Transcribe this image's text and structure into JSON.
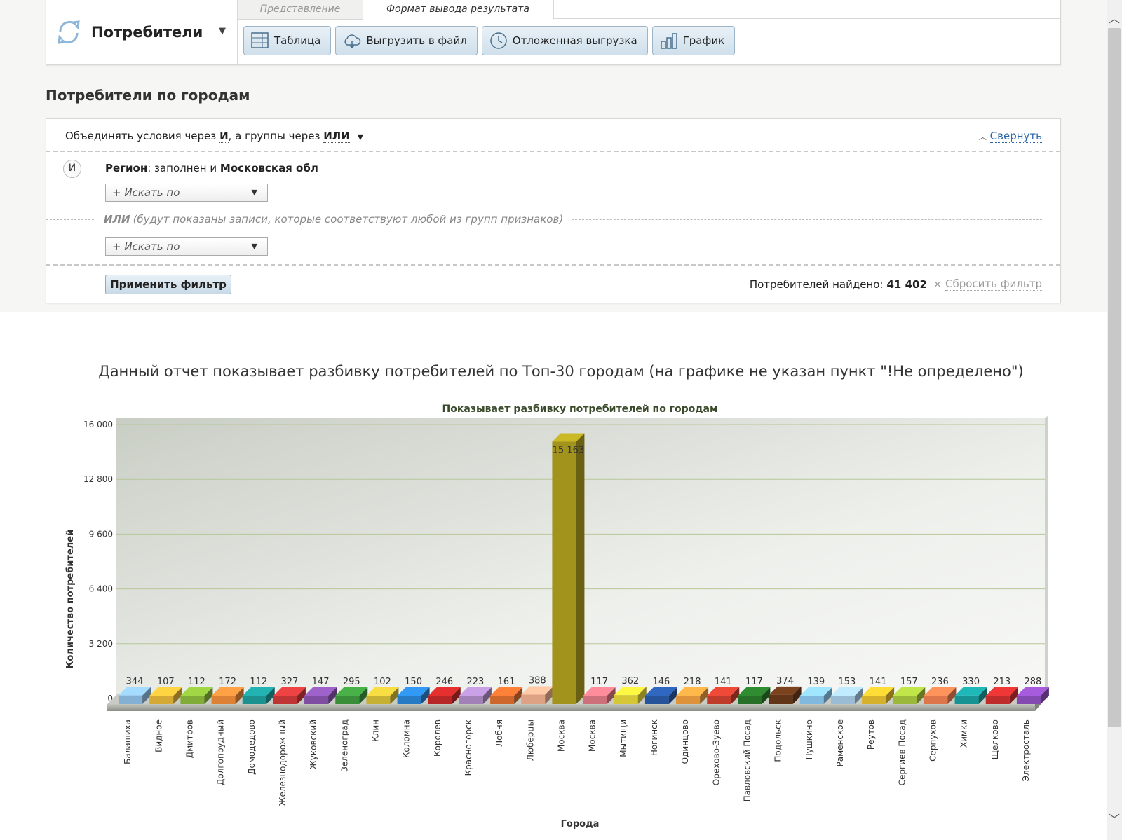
{
  "header": {
    "entity_name": "Потребители",
    "tabs": {
      "view": "Представление",
      "output_format": "Формат вывода результата"
    },
    "buttons": {
      "table": "Таблица",
      "export": "Выгрузить в файл",
      "deferred_export": "Отложенная выгрузка",
      "chart": "График"
    }
  },
  "page": {
    "title": "Потребители по городам"
  },
  "filter": {
    "combine_prefix": "Объединять условия через",
    "combine_and": "И",
    "combine_mid": ", а группы через",
    "combine_or": "ИЛИ",
    "collapse": "Свернуть",
    "and_badge": "И",
    "condition_field": "Регион",
    "condition_mid": ": заполнен и",
    "condition_value": "Московская обл",
    "search_placeholder": "+ Искать по",
    "or_label": "ИЛИ",
    "or_note": "(будут показаны записи, которые соответствуют любой из групп признаков)",
    "apply": "Применить фильтр",
    "found_label": "Потребителей найдено:",
    "found_count": "41 402",
    "reset": "Сбросить фильтр"
  },
  "report": {
    "caption": "Данный отчет показывает разбивку потребителей по Топ-30 городам (на графике не указан пункт \"!Не определено\")"
  },
  "chart_data": {
    "type": "bar",
    "title": "Показывает разбивку потребителей по городам",
    "xlabel": "Города",
    "ylabel": "Количество потребителей",
    "ylim": [
      0,
      16000
    ],
    "yticks": [
      0,
      3200,
      6400,
      9600,
      12800,
      16000
    ],
    "ytick_labels": [
      "0",
      "3 200",
      "6 400",
      "9 600",
      "12 800",
      "16 000"
    ],
    "categories": [
      "Балашиха",
      "Видное",
      "Дмитров",
      "Долгопрудный",
      "Домодедово",
      "Железнодорожный",
      "Жуковский",
      "Зеленоград",
      "Клин",
      "Коломна",
      "Королев",
      "Красногорск",
      "Лобня",
      "Люберцы",
      "Москва",
      "Москва",
      "Мытищи",
      "Ногинск",
      "Одинцово",
      "Орехово-Зуево",
      "Павловский Посад",
      "Подольск",
      "Пушкино",
      "Раменское",
      "Реутов",
      "Сергиев Посад",
      "Серпухов",
      "Химки",
      "Щелково",
      "Электросталь"
    ],
    "values": [
      344,
      107,
      112,
      172,
      112,
      327,
      147,
      295,
      102,
      150,
      246,
      223,
      161,
      388,
      15163,
      117,
      362,
      146,
      218,
      141,
      117,
      374,
      139,
      153,
      141,
      157,
      236,
      330,
      213,
      288
    ],
    "value_labels": [
      "344",
      "107",
      "112",
      "172",
      "112",
      "327",
      "147",
      "295",
      "102",
      "150",
      "246",
      "223",
      "161",
      "388",
      "15 163",
      "117",
      "362",
      "146",
      "218",
      "141",
      "117",
      "374",
      "139",
      "153",
      "141",
      "157",
      "236",
      "330",
      "213",
      "288"
    ],
    "colors": [
      "#8fbfe6",
      "#e8b83a",
      "#8cbb3c",
      "#f08c3c",
      "#1f9c9c",
      "#d03a3a",
      "#8a54b0",
      "#3f9a3f",
      "#d8c03a",
      "#2a86d6",
      "#c82a2a",
      "#b08cc8",
      "#e07030",
      "#f0b090",
      "#b0a020",
      "#e07a86",
      "#e8d83a",
      "#2a5aa8",
      "#f0a040",
      "#d04030",
      "#2a7a2a",
      "#6a3a1a",
      "#8cc8f0",
      "#a8cce8",
      "#e8c030",
      "#a8c840",
      "#f08050",
      "#1aa0a0",
      "#d03030",
      "#9050c0"
    ],
    "grid": true,
    "legend": "none"
  }
}
